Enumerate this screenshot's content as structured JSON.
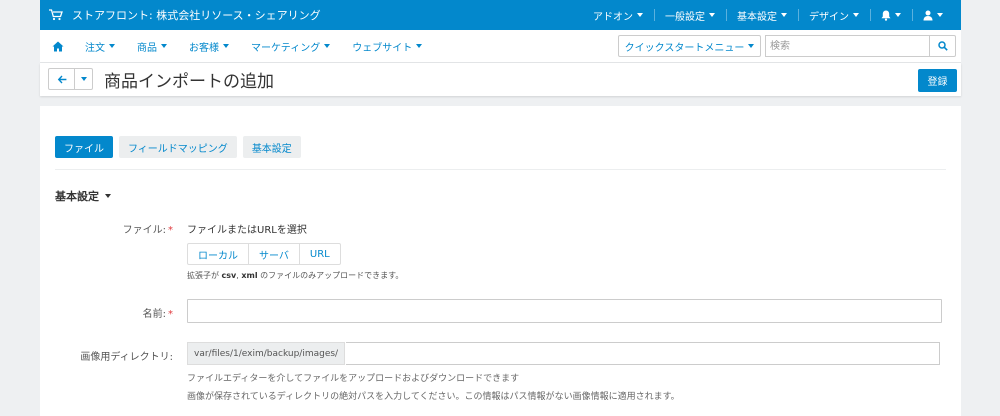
{
  "topbar": {
    "store_name": "ストアフロント: 株式会社リソース・シェアリング",
    "menu": [
      {
        "label": "アドオン"
      },
      {
        "label": "一般設定"
      },
      {
        "label": "基本設定"
      },
      {
        "label": "デザイン"
      }
    ],
    "icons": [
      "cart-icon",
      "bell-icon",
      "user-icon"
    ],
    "color": "#0388cc"
  },
  "navbar": {
    "items": [
      {
        "label": "注文"
      },
      {
        "label": "商品"
      },
      {
        "label": "お客様"
      },
      {
        "label": "マーケティング"
      },
      {
        "label": "ウェブサイト"
      }
    ],
    "quickstart_label": "クイックスタートメニュー",
    "search": {
      "placeholder": "検索",
      "value": ""
    }
  },
  "titlebar": {
    "title": "商品インポートの追加",
    "save_label": "登録"
  },
  "tabs": [
    {
      "label": "ファイル",
      "active": true
    },
    {
      "label": "フィールドマッピング",
      "active": false
    },
    {
      "label": "基本設定",
      "active": false
    }
  ],
  "section": {
    "heading": "基本設定"
  },
  "form": {
    "file": {
      "label": "ファイル:",
      "required_mark": "*",
      "prompt": "ファイルまたはURLを選択",
      "sources": [
        {
          "label": "ローカル"
        },
        {
          "label": "サーバ"
        },
        {
          "label": "URL"
        }
      ],
      "hint_prefix": "拡張子が ",
      "hint_ext1": "csv",
      "hint_sep": ", ",
      "hint_ext2": "xml",
      "hint_suffix": " のファイルのみアップロードできます。"
    },
    "name": {
      "label": "名前:",
      "required_mark": "*",
      "value": ""
    },
    "image_dir": {
      "label": "画像用ディレクトリ:",
      "prefix": "var/files/1/exim/backup/images/",
      "value": "",
      "help1": "ファイルエディターを介してファイルをアップロードおよびダウンロードできます",
      "help2": "画像が保存されているディレクトリの絶対パスを入力してください。この情報はパス情報がない画像情報に適用されます。"
    }
  }
}
